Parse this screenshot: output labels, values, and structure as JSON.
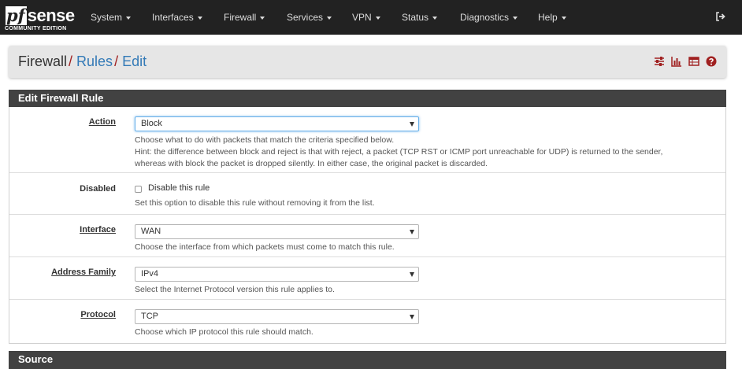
{
  "brand": {
    "pf": "pf",
    "sense": "sense",
    "sub": "COMMUNITY EDITION"
  },
  "nav": {
    "items": [
      "System",
      "Interfaces",
      "Firewall",
      "Services",
      "VPN",
      "Status",
      "Diagnostics",
      "Help"
    ],
    "logout_icon": "sign-out-icon"
  },
  "breadcrumb": {
    "root": "Firewall",
    "sep1": "/",
    "rules": "Rules",
    "sep2": "/",
    "current": "Edit",
    "icons": [
      "sliders-icon",
      "bar-chart-icon",
      "table-icon",
      "question-circle-icon"
    ],
    "icon_colors": {
      "accent": "#a02020"
    }
  },
  "edit_panel": {
    "title": "Edit Firewall Rule",
    "action": {
      "label": "Action",
      "value": "Block",
      "help1": "Choose what to do with packets that match the criteria specified below.",
      "help2": "Hint: the difference between block and reject is that with reject, a packet (TCP RST or ICMP port unreachable for UDP) is returned to the sender,",
      "help3": "whereas with block the packet is dropped silently. In either case, the original packet is discarded."
    },
    "disabled": {
      "label": "Disabled",
      "checkbox_label": "Disable this rule",
      "checked": false,
      "help": "Set this option to disable this rule without removing it from the list."
    },
    "interface": {
      "label": "Interface",
      "value": "WAN",
      "help": "Choose the interface from which packets must come to match this rule."
    },
    "address_family": {
      "label": "Address Family",
      "value": "IPv4",
      "help": "Select the Internet Protocol version this rule applies to."
    },
    "protocol": {
      "label": "Protocol",
      "value": "TCP",
      "help": "Choose which IP protocol this rule should match."
    }
  },
  "source_panel": {
    "title": "Source"
  }
}
